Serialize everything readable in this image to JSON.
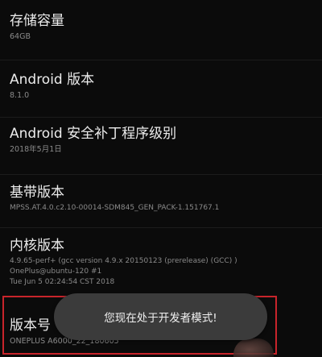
{
  "settings": [
    {
      "title": "存储容量",
      "lines": [
        "64GB"
      ]
    },
    {
      "title": "Android 版本",
      "lines": [
        "8.1.0"
      ]
    },
    {
      "title": "Android 安全补丁程序级别",
      "lines": [
        "2018年5月1日"
      ]
    },
    {
      "title": "基带版本",
      "lines": [
        "MPSS.AT.4.0.c2.10-00014-SDM845_GEN_PACK-1.151767.1"
      ]
    },
    {
      "title": "内核版本",
      "lines": [
        "4.9.65-perf+ (gcc version 4.9.x 20150123 (prerelease) (GCC) )",
        "OnePlus@ubuntu-120 #1",
        "Tue Jun 5 02:24:54 CST 2018"
      ]
    },
    {
      "title": "版本号",
      "lines": [
        "ONEPLUS A6000_22_180605"
      ]
    }
  ],
  "toast": {
    "message": "您现在处于开发者模式!"
  },
  "colors": {
    "highlight": "#c8242b",
    "toast_bg": "#3b3b3b",
    "background": "#0b0b0b"
  }
}
